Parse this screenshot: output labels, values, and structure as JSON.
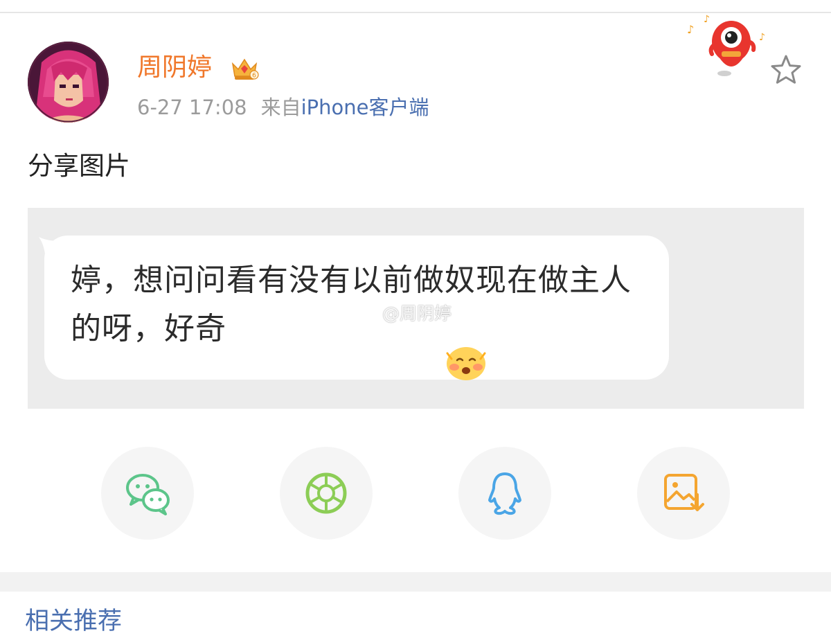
{
  "post": {
    "author": {
      "name": "周阴婷",
      "avatar_icon": "pixel-art-red-hair-avatar",
      "badge_icon": "crown-vip-badge-icon"
    },
    "time": "6-27 17:08",
    "from_label": "来自",
    "source": "iPhone客户端",
    "text": "分享图片",
    "image": {
      "bubble_text": "婷，想问问看有没有以前做奴现在做主人的呀，好奇",
      "emoji": "blush-emoji",
      "watermark": "@周阴婷"
    }
  },
  "share": [
    {
      "name": "wechat",
      "icon": "wechat-icon",
      "color": "#5cc58a"
    },
    {
      "name": "moments",
      "icon": "moments-aperture-icon",
      "color": "#8ccd56"
    },
    {
      "name": "qq",
      "icon": "qq-penguin-icon",
      "color": "#4aa5e6"
    },
    {
      "name": "save-image",
      "icon": "save-image-icon",
      "color": "#f4a530"
    }
  ],
  "related": {
    "title": "相关推荐"
  },
  "colors": {
    "username": "#f0772a",
    "link": "#4a6fb0",
    "meta": "#9b9b9b"
  }
}
